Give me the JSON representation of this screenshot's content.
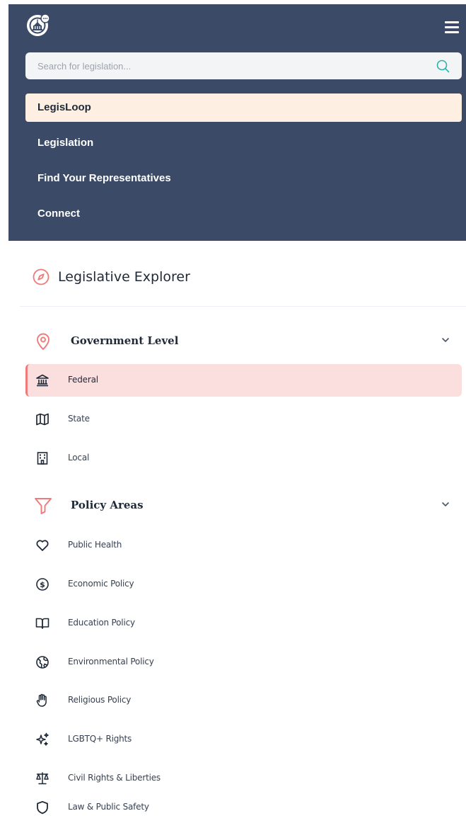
{
  "header": {
    "search": {
      "placeholder": "Search for legislation...",
      "value": ""
    },
    "nav": [
      {
        "label": "LegisLoop",
        "active": true
      },
      {
        "label": "Legislation",
        "active": false
      },
      {
        "label": "Find Your Representatives",
        "active": false
      },
      {
        "label": "Connect",
        "active": false
      }
    ]
  },
  "explorer": {
    "title": "Legislative Explorer",
    "government_level": {
      "label": "Government Level",
      "items": [
        {
          "label": "Federal",
          "icon": "landmark-icon",
          "selected": true
        },
        {
          "label": "State",
          "icon": "map-icon",
          "selected": false
        },
        {
          "label": "Local",
          "icon": "building-icon",
          "selected": false
        }
      ]
    },
    "policy_areas": {
      "label": "Policy Areas",
      "items": [
        {
          "label": "Public Health",
          "icon": "heart-icon"
        },
        {
          "label": "Economic Policy",
          "icon": "dollar-circle-icon"
        },
        {
          "label": "Education Policy",
          "icon": "book-open-icon"
        },
        {
          "label": "Environmental Policy",
          "icon": "globe-icon"
        },
        {
          "label": "Religious Policy",
          "icon": "hand-icon"
        },
        {
          "label": "LGBTQ+ Rights",
          "icon": "sparkles-icon"
        },
        {
          "label": "Civil Rights & Liberties",
          "icon": "scale-icon"
        },
        {
          "label": "Law & Public Safety",
          "icon": "shield-icon"
        }
      ]
    }
  },
  "colors": {
    "nav_bg": "#3a4a67",
    "active_nav_bg": "#fdf0e3",
    "accent": "#f07a7a",
    "selected_bg": "#fbdfdf"
  }
}
